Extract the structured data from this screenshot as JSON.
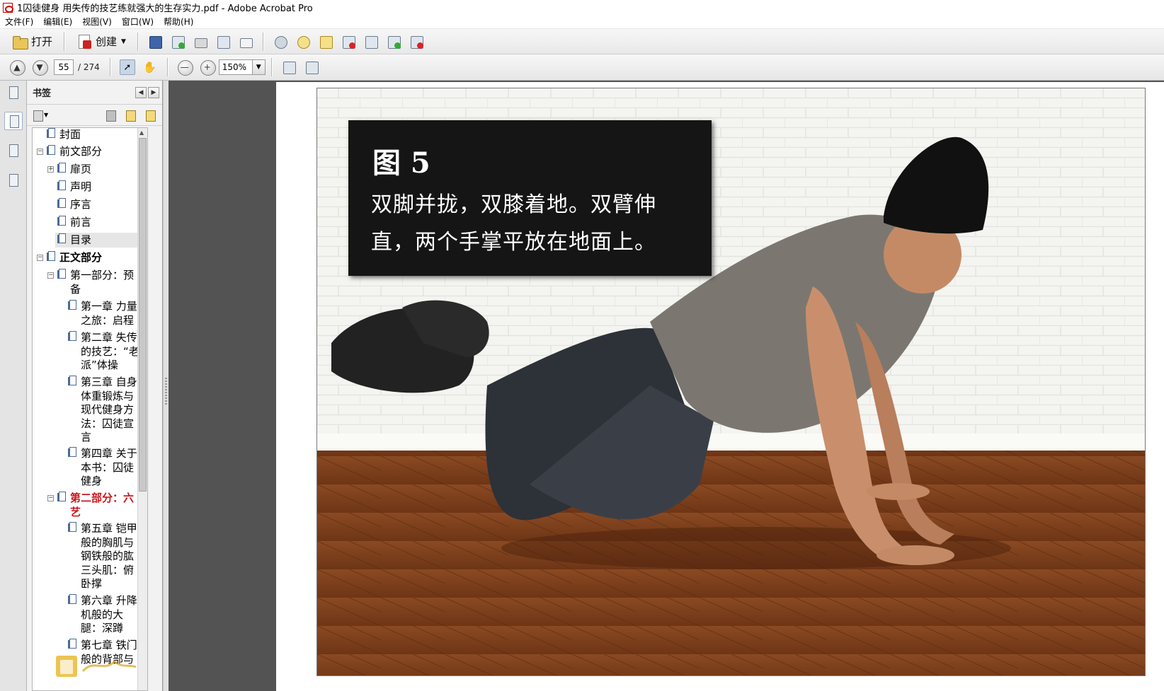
{
  "window": {
    "title": "1囚徒健身 用失传的技艺练就强大的生存实力.pdf - Adobe Acrobat Pro"
  },
  "menubar": [
    "文件(F)",
    "编辑(E)",
    "视图(V)",
    "窗口(W)",
    "帮助(H)"
  ],
  "toolbar": {
    "open_label": "打开",
    "create_label": "创建",
    "icons": [
      "open-folder-icon",
      "create-pdf-icon",
      "save-icon",
      "upload-icon",
      "print-icon",
      "edit-icon",
      "email-icon",
      "settings-icon",
      "comment-icon",
      "highlight-icon",
      "delete-pdf-icon",
      "search-doc-icon",
      "export-icon",
      "sign-icon"
    ]
  },
  "navigation": {
    "current_page": "55",
    "total_pages": "/ 274",
    "zoom": "150%"
  },
  "bookmarks_panel": {
    "title": "书签",
    "items": [
      {
        "label": "封面"
      },
      {
        "label": "前文部分"
      },
      {
        "label": "扉页"
      },
      {
        "label": "声明"
      },
      {
        "label": "序言"
      },
      {
        "label": "前言"
      },
      {
        "label": "目录"
      },
      {
        "label": "正文部分"
      },
      {
        "label": "第一部分：预备"
      },
      {
        "label": "第一章 力量之旅：启程"
      },
      {
        "label": "第二章 失传的技艺：“老派”体操"
      },
      {
        "label": "第三章 自身体重锻炼与现代健身方法：囚徒宣言"
      },
      {
        "label": "第四章 关于本书：囚徒健身"
      },
      {
        "label": "第二部分：六艺"
      },
      {
        "label": "第五章 铠甲般的胸肌与钢铁般的肱三头肌：俯卧撑"
      },
      {
        "label": "第六章 升降机般的大腿：深蹲"
      },
      {
        "label": "第七章 铁门般的背部与"
      }
    ]
  },
  "document": {
    "figure_title": "图 5",
    "caption_lines": [
      "双脚并拢，双膝着地。双臂伸",
      "直，两个手掌平放在地面上。"
    ]
  },
  "colors": {
    "canvas": "#535353",
    "selected_bookmark": "#c8171c",
    "caption_bg": "#151515"
  }
}
